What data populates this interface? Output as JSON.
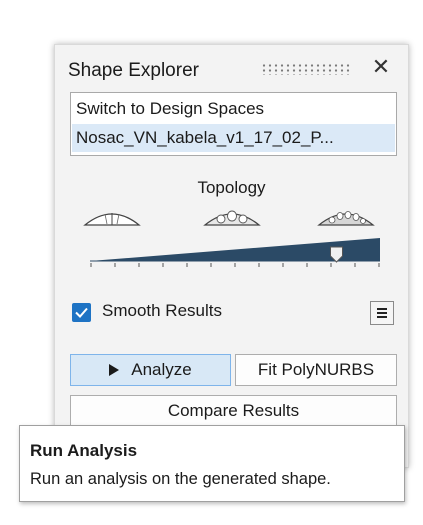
{
  "panel": {
    "title": "Shape Explorer",
    "close_icon": "close-icon",
    "grip_icon": "drag-grip-icon"
  },
  "list": {
    "items": [
      {
        "label": "Switch to Design Spaces",
        "selected": false
      },
      {
        "label": "Nosac_VN_kabela_v1_17_02_P...",
        "selected": true
      }
    ]
  },
  "topology": {
    "label": "Topology",
    "icons": [
      "topology-low-icon",
      "topology-medium-icon",
      "topology-high-icon"
    ],
    "slider_level": 0.85
  },
  "smooth": {
    "label": "Smooth Results",
    "checked": true,
    "menu_icon": "menu-icon"
  },
  "buttons": {
    "analyze": "Analyze",
    "fit": "Fit PolyNURBS",
    "compare": "Compare Results"
  },
  "tooltip": {
    "title": "Run Analysis",
    "description": "Run an analysis on the generated shape."
  },
  "colors": {
    "accent": "#1e73c4",
    "selection": "#dbe9f7",
    "slider_fill": "#2b4a66",
    "panel_bg": "#f3f3f3"
  }
}
